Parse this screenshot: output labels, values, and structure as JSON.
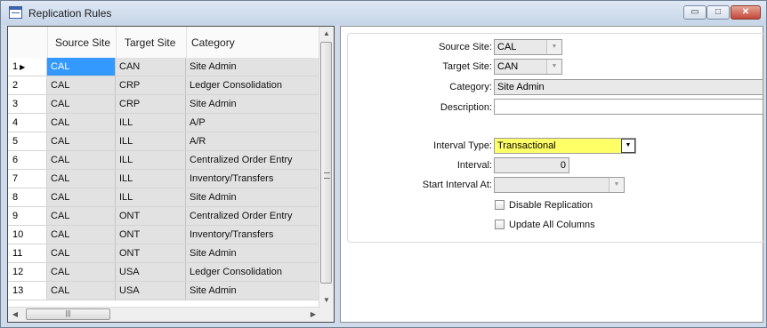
{
  "window": {
    "title": "Replication Rules",
    "controls": {
      "minimize": "▭",
      "maximize": "□",
      "close": "✕"
    }
  },
  "grid": {
    "columns": [
      "Source Site",
      "Target Site",
      "Category"
    ],
    "rows": [
      {
        "num": "1",
        "source": "CAL",
        "target": "CAN",
        "category": "Site Admin",
        "current": true
      },
      {
        "num": "2",
        "source": "CAL",
        "target": "CRP",
        "category": "Ledger Consolidation"
      },
      {
        "num": "3",
        "source": "CAL",
        "target": "CRP",
        "category": "Site Admin"
      },
      {
        "num": "4",
        "source": "CAL",
        "target": "ILL",
        "category": "A/P"
      },
      {
        "num": "5",
        "source": "CAL",
        "target": "ILL",
        "category": "A/R"
      },
      {
        "num": "6",
        "source": "CAL",
        "target": "ILL",
        "category": "Centralized Order Entry"
      },
      {
        "num": "7",
        "source": "CAL",
        "target": "ILL",
        "category": "Inventory/Transfers"
      },
      {
        "num": "8",
        "source": "CAL",
        "target": "ILL",
        "category": "Site Admin"
      },
      {
        "num": "9",
        "source": "CAL",
        "target": "ONT",
        "category": "Centralized Order Entry"
      },
      {
        "num": "10",
        "source": "CAL",
        "target": "ONT",
        "category": "Inventory/Transfers"
      },
      {
        "num": "11",
        "source": "CAL",
        "target": "ONT",
        "category": "Site Admin"
      },
      {
        "num": "12",
        "source": "CAL",
        "target": "USA",
        "category": "Ledger Consolidation"
      },
      {
        "num": "13",
        "source": "CAL",
        "target": "USA",
        "category": "Site Admin"
      }
    ]
  },
  "form": {
    "source_site": {
      "label": "Source Site:",
      "value": "CAL"
    },
    "target_site": {
      "label": "Target Site:",
      "value": "CAN"
    },
    "category": {
      "label": "Category:",
      "value": "Site Admin"
    },
    "description": {
      "label": "Description:",
      "value": ""
    },
    "interval_type": {
      "label": "Interval Type:",
      "value": "Transactional"
    },
    "interval": {
      "label": "Interval:",
      "value": "0"
    },
    "start_interval_at": {
      "label": "Start Interval At:",
      "value": ""
    },
    "disable_replication": {
      "label": "Disable Replication",
      "checked": false
    },
    "update_all_columns": {
      "label": "Update All Columns",
      "checked": false
    }
  },
  "colors": {
    "selection": "#3399ff",
    "interval_type_bg": "#ffff66",
    "frame": "#cfdbea"
  },
  "icons": [
    "window-app-icon",
    "minimize-icon",
    "maximize-icon",
    "close-icon",
    "row-indicator-arrow-icon",
    "scroll-up-icon",
    "scroll-down-icon",
    "scroll-left-icon",
    "scroll-right-icon",
    "dropdown-arrow-icon"
  ]
}
